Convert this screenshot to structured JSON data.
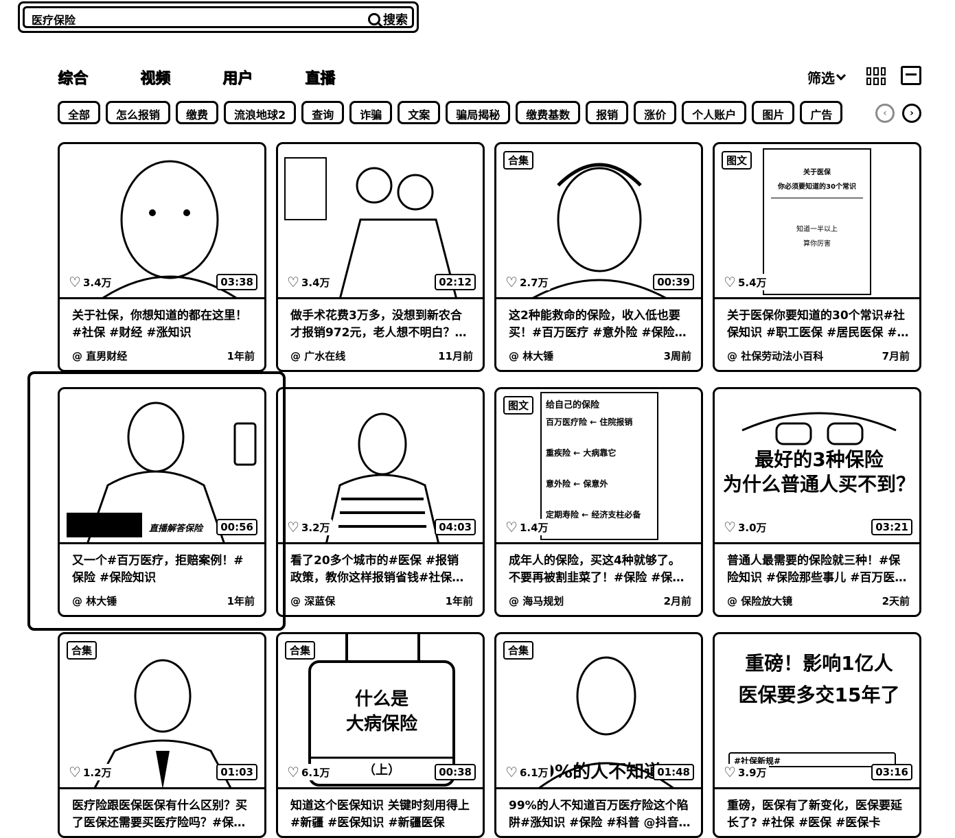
{
  "search": {
    "value": "医疗保险",
    "button_label": "搜索"
  },
  "tabs": [
    "综合",
    "视频",
    "用户",
    "直播"
  ],
  "filter_label": "筛选",
  "chips": [
    "全部",
    "怎么报销",
    "缴费",
    "流浪地球2",
    "查询",
    "诈骗",
    "文案",
    "骗局揭秘",
    "缴费基数",
    "报销",
    "涨价",
    "个人账户",
    "图片",
    "广告"
  ],
  "cards": [
    {
      "likes": "3.4万",
      "duration": "03:38",
      "badge": "",
      "title": "关于社保，你想知道的都在这里！#社保 #财经 #涨知识",
      "author": "@ 直男财经",
      "time": "1年前"
    },
    {
      "likes": "3.4万",
      "duration": "02:12",
      "badge": "",
      "title": "做手术花费3万多，没想到新农合才报销972元，老人想不明白？#…",
      "author": "@ 广水在线",
      "time": "11月前"
    },
    {
      "likes": "2.7万",
      "duration": "00:39",
      "badge": "合集",
      "title": "这2种能救命的保险，收入低也要买！#百万医疗 #意外险 #保险知识",
      "author": "@ 林大锤",
      "time": "3周前"
    },
    {
      "likes": "5.4万",
      "duration": "",
      "badge": "图文",
      "title": "关于医保你要知道的30个常识#社保知识 #职工医保 #居民医保 #…",
      "author": "@ 社保劳动法小百科",
      "time": "7月前",
      "doc": {
        "title1": "关于医保",
        "title2": "你必须要知道的30个常识",
        "line1": "知道一半以上",
        "line2": "算你厉害"
      }
    },
    {
      "likes": "",
      "duration": "00:56",
      "badge": "",
      "title": "又一个#百万医疗，拒赔案例！#保险 #保险知识",
      "author": "@ 林大锤",
      "time": "1年前",
      "overlay": "直播解答保险"
    },
    {
      "likes": "3.2万",
      "duration": "04:03",
      "badge": "",
      "title": "看了20多个城市的#医保 #报销 政策，教你这样报销省钱#社保 #…",
      "author": "@ 深蓝保",
      "time": "1年前"
    },
    {
      "likes": "1.4万",
      "duration": "",
      "badge": "图文",
      "title": "成年人的保险，买这4种就够了。不要再被割韭菜了！#保险 #保险…",
      "author": "@ 海马规划",
      "time": "2月前",
      "doc": {
        "title1": "给自己的保险",
        "items": [
          "百万医疗险 ← 住院报销",
          "重疾险 ← 大病靠它",
          "意外险 ← 保意外",
          "定期寿险 ← 经济支柱必备"
        ]
      }
    },
    {
      "likes": "3.0万",
      "duration": "03:21",
      "badge": "",
      "title": "普通人最需要的保险就三种！#保险知识 #保险那些事儿 #百万医…",
      "author": "@ 保险放大镜",
      "time": "2天前",
      "overlay1": "最好的3种保险",
      "overlay2": "为什么普通人买不到？"
    },
    {
      "likes": "1.2万",
      "duration": "01:03",
      "badge": "合集",
      "title": "医疗险跟医保医保有什么区别？买了医保还需要买医疗险吗？#保…",
      "author": "",
      "time": ""
    },
    {
      "likes": "6.1万",
      "duration": "00:38",
      "badge": "合集",
      "title": "知道这个医保知识 关键时刻用得上 #新疆 #医保知识 #新疆医保",
      "author": "",
      "time": "",
      "overlay1": "什么是",
      "overlay2": "大病保险",
      "overlay3": "（上）"
    },
    {
      "likes": "6.1万",
      "duration": "01:48",
      "badge": "合集",
      "title": "99%的人不知道百万医疗险这个陷阱#涨知识 #保险 #科普 @抖音…",
      "author": "",
      "time": "",
      "overlay": "99%的人不知道"
    },
    {
      "likes": "3.9万",
      "duration": "03:16",
      "badge": "",
      "title": "重磅，医保有了新变化，医保要延长了? #社保 #医保 #医保卡",
      "author": "",
      "time": "",
      "overlay1": "重磅！影响1亿人",
      "overlay2": "医保要多交15年了",
      "overlay3": "#社保新规#"
    }
  ]
}
